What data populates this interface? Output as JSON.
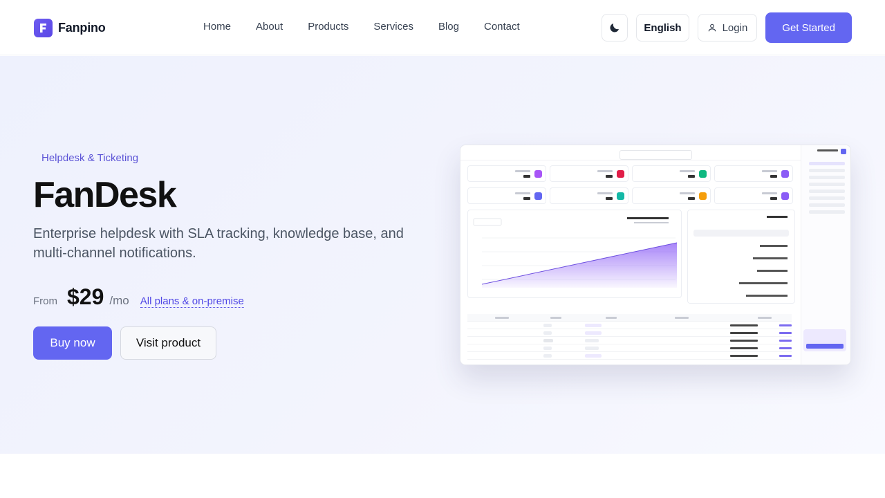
{
  "brand": {
    "name": "Fanpino",
    "logo_letter": "F"
  },
  "nav": {
    "items": [
      "Home",
      "About",
      "Products",
      "Services",
      "Blog",
      "Contact"
    ]
  },
  "header": {
    "theme_icon": "moon-icon",
    "language": "English",
    "login": "Login",
    "cta": "Get Started"
  },
  "hero": {
    "badge": "Helpdesk & Ticketing",
    "title": "FanDesk",
    "description": "Enterprise helpdesk with SLA tracking, knowledge base, and multi-channel notifications.",
    "price_prefix": "From",
    "price": "$29",
    "price_unit": "/mo",
    "price_link": "All plans & on-premise",
    "buy_label": "Buy now",
    "visit_label": "Visit product"
  },
  "colors": {
    "accent": "#6366f1",
    "badge_text": "#5b53d6",
    "hero_bg": "#eef1fd"
  }
}
